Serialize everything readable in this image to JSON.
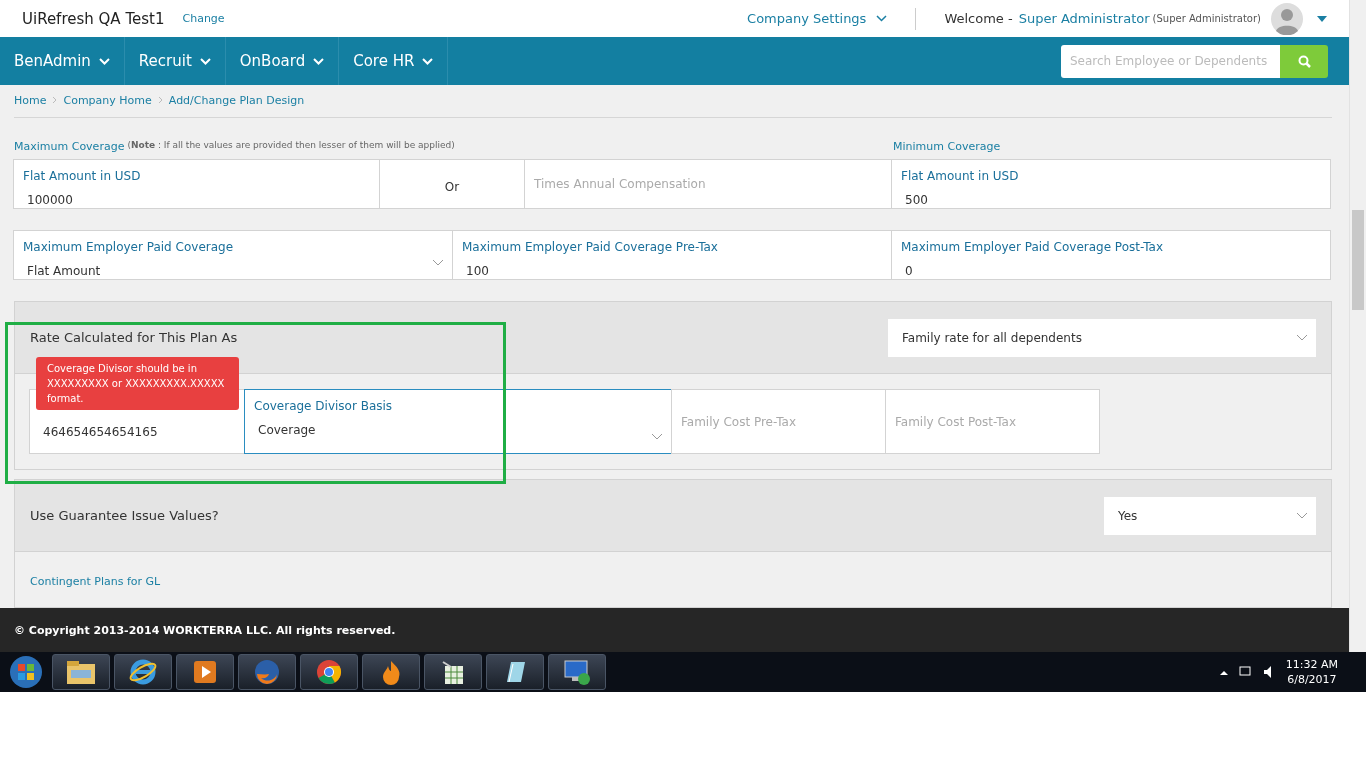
{
  "header": {
    "company": "UiRefresh QA Test1",
    "change_link": "Change",
    "settings": "Company Settings",
    "welcome": "Welcome -",
    "user": "Super Administrator",
    "role": "(Super Administrator)"
  },
  "nav": {
    "items": [
      "BenAdmin",
      "Recruit",
      "OnBoard",
      "Core HR"
    ],
    "search": {
      "placeholder": "Search Employee or Dependents"
    }
  },
  "breadcrumb": [
    "Home",
    "Company Home",
    "Add/Change Plan Design"
  ],
  "max_coverage": {
    "label": "Maximum Coverage",
    "note": "(**Note** : If all the values are provided then lesser of them will be applied)",
    "flat": {
      "label": "Flat Amount in USD",
      "value": "100000"
    },
    "or": "Or",
    "times": {
      "placeholder": "Times Annual Compensation"
    }
  },
  "min_coverage": {
    "label": "Minimum Coverage",
    "flat": {
      "label": "Flat Amount in USD",
      "value": "500"
    }
  },
  "employer_paid": [
    {
      "kind": "select",
      "label": "Maximum Employer Paid Coverage",
      "value": "Flat Amount"
    },
    {
      "kind": "input",
      "label": "Maximum Employer Paid Coverage Pre-Tax",
      "value": "100"
    },
    {
      "kind": "input",
      "label": "Maximum Employer Paid Coverage Post-Tax",
      "value": "0"
    }
  ],
  "rate": {
    "label": "Rate Calculated for This Plan As",
    "value": "Family rate for all dependents",
    "error": "Coverage Divisor should be in XXXXXXXXX or XXXXXXXXX.XXXXX format.",
    "fields": [
      {
        "kind": "input",
        "value": "464654654654165",
        "focused": false
      },
      {
        "kind": "select",
        "label": "Coverage Divisor Basis",
        "value": "Coverage",
        "focused": true
      },
      {
        "kind": "input",
        "placeholder": "Family Cost Pre-Tax",
        "focused": false
      },
      {
        "kind": "input",
        "placeholder": "Family Cost Post-Tax",
        "focused": false
      }
    ]
  },
  "guarantee": {
    "label": "Use Guarantee Issue Values?",
    "value": "Yes"
  },
  "contingent": {
    "label": "Contingent Plans for GL"
  },
  "footer": "© Copyright 2013-2014 WORKTERRA LLC. All rights reserved.",
  "taskbar": {
    "time": "11:32 AM",
    "date": "6/8/2017"
  }
}
